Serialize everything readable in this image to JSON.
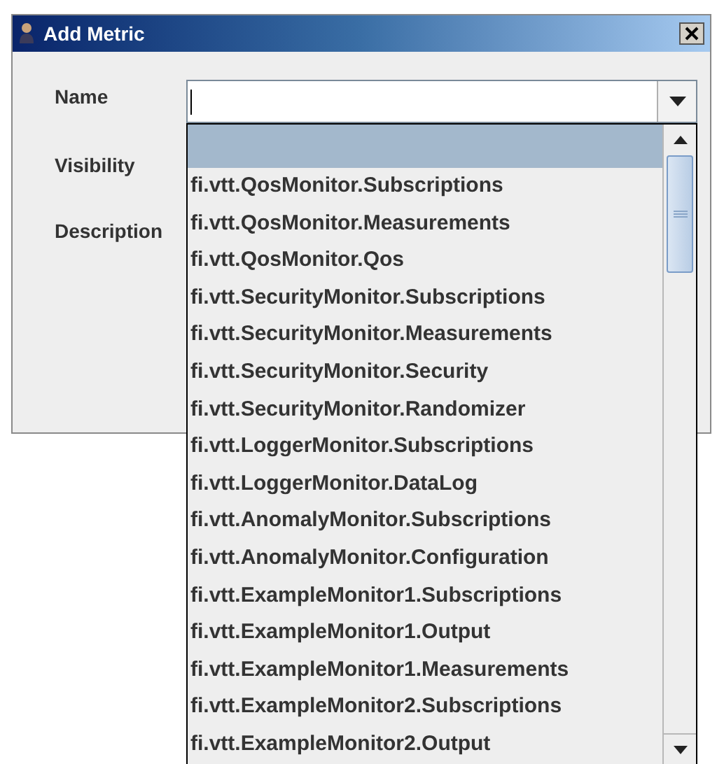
{
  "window": {
    "title": "Add Metric"
  },
  "form": {
    "labels": [
      "Name",
      "Visibility",
      "Description"
    ]
  },
  "dropdown": {
    "items": [
      {
        "selected": true
      },
      {
        "label": "fi.vtt.QosMonitor.Subscriptions",
        "selected": false
      },
      {
        "label": "fi.vtt.QosMonitor.Measurements",
        "selected": false
      },
      {
        "label": "fi.vtt.QosMonitor.Qos",
        "selected": false
      },
      {
        "label": "fi.vtt.SecurityMonitor.Subscriptions",
        "selected": false
      },
      {
        "label": "fi.vtt.SecurityMonitor.Measurements",
        "selected": false
      },
      {
        "label": "fi.vtt.SecurityMonitor.Security",
        "selected": false
      },
      {
        "label": "fi.vtt.SecurityMonitor.Randomizer",
        "selected": false
      },
      {
        "label": "fi.vtt.LoggerMonitor.Subscriptions",
        "selected": false
      },
      {
        "label": "fi.vtt.LoggerMonitor.DataLog",
        "selected": false
      },
      {
        "label": "fi.vtt.AnomalyMonitor.Subscriptions",
        "selected": false
      },
      {
        "label": "fi.vtt.AnomalyMonitor.Configuration",
        "selected": false
      },
      {
        "label": "fi.vtt.ExampleMonitor1.Subscriptions",
        "selected": false
      },
      {
        "label": "fi.vtt.ExampleMonitor1.Output",
        "selected": false
      },
      {
        "label": "fi.vtt.ExampleMonitor1.Measurements",
        "selected": false
      },
      {
        "label": "fi.vtt.ExampleMonitor2.Subscriptions",
        "selected": false
      },
      {
        "label": "fi.vtt.ExampleMonitor2.Output",
        "selected": false
      }
    ]
  }
}
